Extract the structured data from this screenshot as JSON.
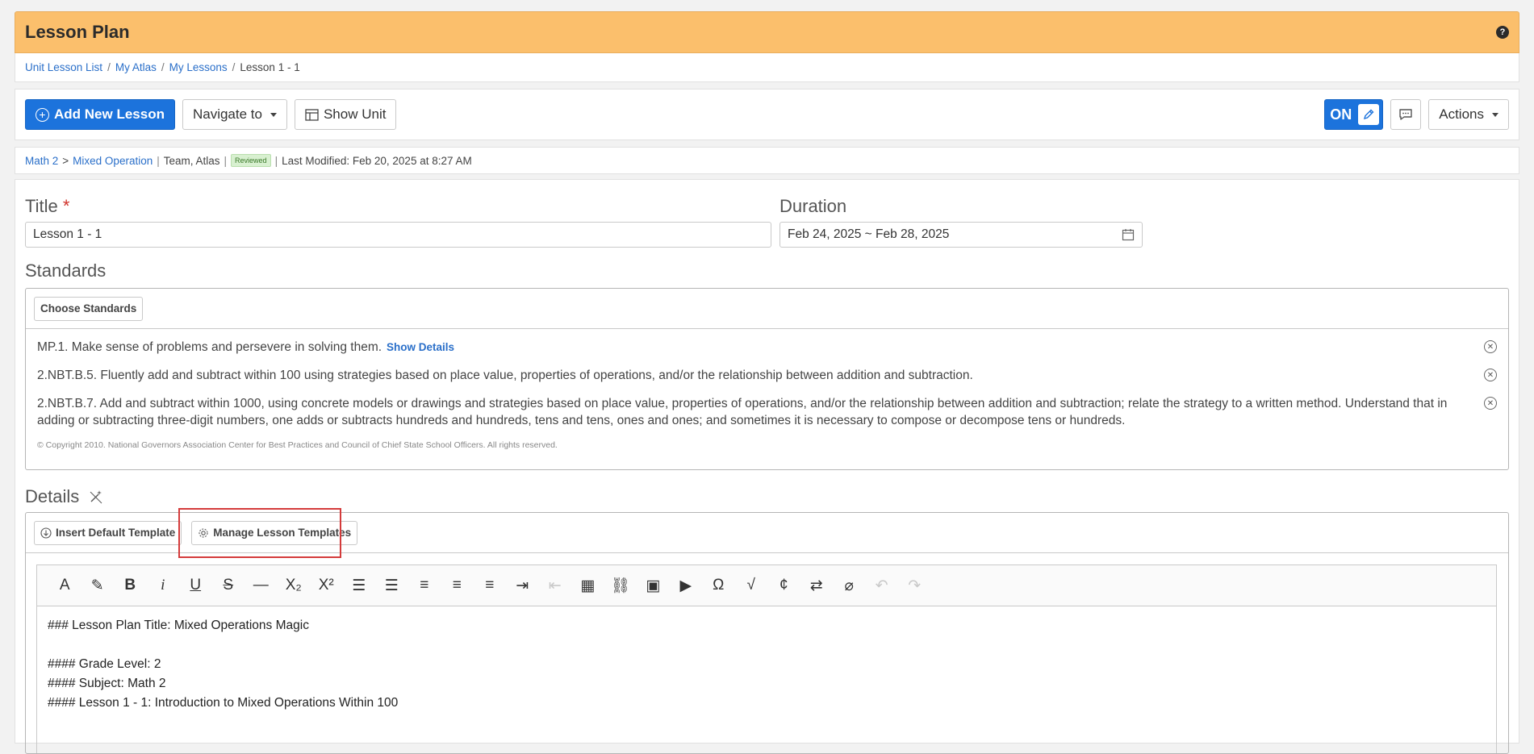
{
  "header": {
    "title": "Lesson Plan",
    "help_icon": "?"
  },
  "breadcrumb": {
    "items": [
      "Unit Lesson List",
      "My Atlas",
      "My Lessons"
    ],
    "current": "Lesson 1 - 1",
    "separator": "/"
  },
  "toolbar": {
    "add_new_lesson": "Add New Lesson",
    "navigate_to": "Navigate to",
    "show_unit": "Show Unit",
    "toggle_label": "ON",
    "actions": "Actions"
  },
  "meta": {
    "course": "Math 2",
    "arrow": ">",
    "unit": "Mixed Operation",
    "author": "Team, Atlas",
    "badge": "Reviewed",
    "last_modified": "Last Modified: Feb 20, 2025 at 8:27 AM",
    "divider": "|"
  },
  "form": {
    "title_label": "Title",
    "required_mark": "*",
    "title_value": "Lesson 1 - 1",
    "duration_label": "Duration",
    "duration_value": "Feb 24, 2025 ~ Feb 28, 2025"
  },
  "standards": {
    "label": "Standards",
    "choose_button": "Choose Standards",
    "show_details": "Show Details",
    "items": [
      {
        "text": "MP.1. Make sense of problems and persevere in solving them."
      },
      {
        "text": "2.NBT.B.5. Fluently add and subtract within 100 using strategies based on place value, properties of operations, and/or the relationship between addition and subtraction."
      },
      {
        "text": "2.NBT.B.7. Add and subtract within 1000, using concrete models or drawings and strategies based on place value, properties of operations, and/or the relationship between addition and subtraction; relate the strategy to a written method. Understand that in adding or subtracting three-digit numbers, one adds or subtracts hundreds and hundreds, tens and tens, ones and ones; and sometimes it is necessary to compose or decompose tens or hundreds."
      }
    ],
    "copyright": "© Copyright 2010. National Governors Association Center for Best Practices and Council of Chief State School Officers. All rights reserved."
  },
  "details": {
    "label": "Details",
    "insert_default_template": "Insert Default Template",
    "manage_lesson_templates": "Manage Lesson Templates",
    "editor_lines": [
      "### Lesson Plan Title: Mixed Operations Magic",
      "",
      "#### Grade Level: 2",
      "#### Subject: Math 2",
      "#### Lesson 1 - 1: Introduction to Mixed Operations Within 100"
    ],
    "editor_tools": [
      "text-color",
      "highlight",
      "bold",
      "italic",
      "underline",
      "strikethrough",
      "horizontal-rule",
      "subscript",
      "superscript",
      "ordered-list",
      "unordered-list",
      "align-left",
      "align-center",
      "align-right",
      "indent",
      "outdent",
      "table",
      "link",
      "image",
      "video",
      "special-char",
      "math",
      "code",
      "swap",
      "clear-format",
      "undo",
      "redo"
    ]
  },
  "colors": {
    "header_bg": "#fbbf6c",
    "accent": "#1c73dc",
    "highlight_border": "#d43b3b"
  }
}
